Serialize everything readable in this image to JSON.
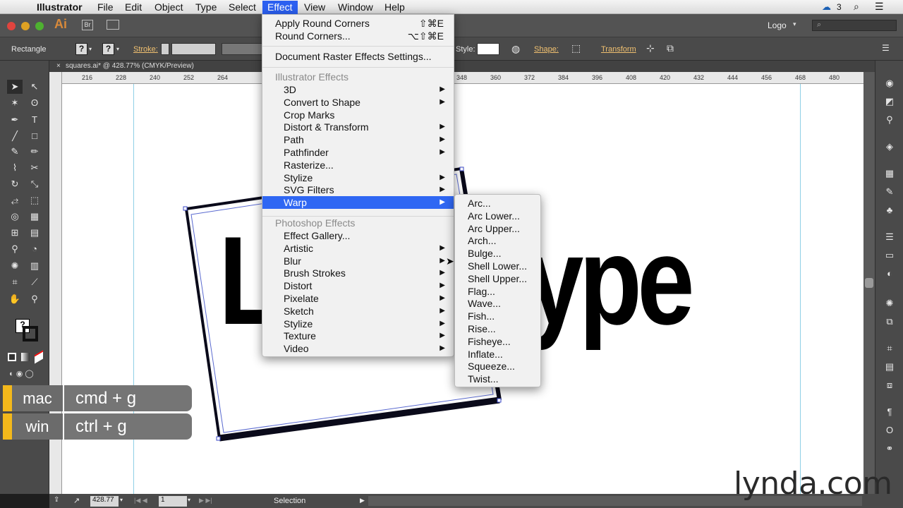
{
  "menubar": {
    "app": "Illustrator",
    "items": [
      "File",
      "Edit",
      "Object",
      "Type",
      "Select",
      "Effect",
      "View",
      "Window",
      "Help"
    ],
    "cc_count": "3"
  },
  "appbar": {
    "ai_label": "Ai",
    "br_label": "Br",
    "workspace": "Logo",
    "search_placeholder": ""
  },
  "control": {
    "selection_type": "Rectangle",
    "stroke_label": "Stroke:",
    "style_label": "Style:",
    "shape_label": "Shape:",
    "transform_label": "Transform",
    "q1": "?",
    "q2": "?"
  },
  "document_tab": "squares.ai* @ 428.77% (CMYK/Preview)",
  "ruler_ticks": [
    "216",
    "228",
    "240",
    "252",
    "264",
    "348",
    "360",
    "372",
    "384",
    "396",
    "408",
    "420",
    "432",
    "444",
    "456",
    "468",
    "480"
  ],
  "effect_menu": {
    "apply": {
      "label": "Apply Round Corners",
      "shortcut": "⇧⌘E"
    },
    "last": {
      "label": "Round Corners...",
      "shortcut": "⌥⇧⌘E"
    },
    "raster": "Document Raster Effects Settings...",
    "illustrator_header": "Illustrator Effects",
    "illustrator_items": [
      {
        "label": "3D",
        "sub": true
      },
      {
        "label": "Convert to Shape",
        "sub": true
      },
      {
        "label": "Crop Marks",
        "sub": false
      },
      {
        "label": "Distort & Transform",
        "sub": true
      },
      {
        "label": "Path",
        "sub": true
      },
      {
        "label": "Pathfinder",
        "sub": true
      },
      {
        "label": "Rasterize...",
        "sub": false
      },
      {
        "label": "Stylize",
        "sub": true
      },
      {
        "label": "SVG Filters",
        "sub": true
      },
      {
        "label": "Warp",
        "sub": true
      }
    ],
    "photoshop_header": "Photoshop Effects",
    "photoshop_items": [
      {
        "label": "Effect Gallery...",
        "sub": false
      },
      {
        "label": "Artistic",
        "sub": true
      },
      {
        "label": "Blur",
        "sub": true
      },
      {
        "label": "Brush Strokes",
        "sub": true
      },
      {
        "label": "Distort",
        "sub": true
      },
      {
        "label": "Pixelate",
        "sub": true
      },
      {
        "label": "Sketch",
        "sub": true
      },
      {
        "label": "Stylize",
        "sub": true
      },
      {
        "label": "Texture",
        "sub": true
      },
      {
        "label": "Video",
        "sub": true
      }
    ]
  },
  "warp_menu": [
    "Arc...",
    "Arc Lower...",
    "Arc Upper...",
    "Arch...",
    "Bulge...",
    "Shell Lower...",
    "Shell Upper...",
    "Flag...",
    "Wave...",
    "Fish...",
    "Rise...",
    "Fisheye...",
    "Inflate...",
    "Squeeze...",
    "Twist..."
  ],
  "artwork_text": "Logo Type",
  "shortcut_overlay": {
    "mac_os": "mac",
    "mac_key": "cmd + g",
    "win_os": "win",
    "win_key": "ctrl + g"
  },
  "status": {
    "zoom": "428.77",
    "page": "1",
    "tool": "Selection"
  },
  "watermark": "lynda.com"
}
